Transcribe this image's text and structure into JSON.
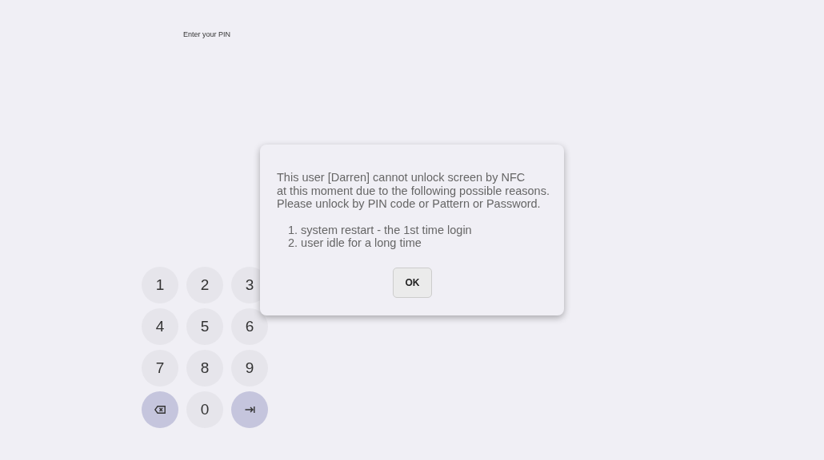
{
  "prompt": "Enter your PIN",
  "keypad": [
    {
      "kind": "digit",
      "label": "1"
    },
    {
      "kind": "digit",
      "label": "2"
    },
    {
      "kind": "digit",
      "label": "3"
    },
    {
      "kind": "digit",
      "label": "4"
    },
    {
      "kind": "digit",
      "label": "5"
    },
    {
      "kind": "digit",
      "label": "6"
    },
    {
      "kind": "digit",
      "label": "7"
    },
    {
      "kind": "digit",
      "label": "8"
    },
    {
      "kind": "digit",
      "label": "9"
    },
    {
      "kind": "backspace"
    },
    {
      "kind": "digit",
      "label": "0"
    },
    {
      "kind": "enter"
    }
  ],
  "dialog": {
    "message_lines": [
      "This user [Darren] cannot unlock screen by NFC",
      "at this moment due to the following possible reasons.",
      "Please unlock by PIN code or Pattern or Password."
    ],
    "reasons": [
      "1. system restart - the 1st time login",
      "2. user idle for a long time"
    ],
    "button": "OK"
  }
}
